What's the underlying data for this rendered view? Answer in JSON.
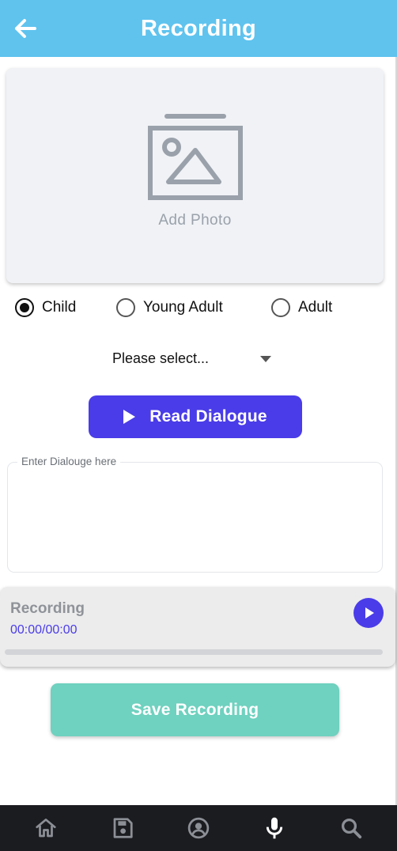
{
  "header": {
    "title": "Recording",
    "color": "#5fc3ee",
    "back_icon": "arrow-left-icon"
  },
  "photo": {
    "label": "Add Photo",
    "icon": "image-placeholder-icon"
  },
  "age_group": {
    "options": [
      {
        "label": "Child",
        "checked": true
      },
      {
        "label": "Young Adult",
        "checked": false
      },
      {
        "label": "Adult",
        "checked": false
      }
    ]
  },
  "select": {
    "value": "Please select..."
  },
  "read_button": {
    "label": "Read Dialogue",
    "icon": "play-icon",
    "color": "#4a3ce8"
  },
  "dialogue": {
    "placeholder": "Enter Dialouge here",
    "value": ""
  },
  "recorder": {
    "title": "Recording",
    "time": "00:00/00:00",
    "progress": 0,
    "play_icon": "play-circle-icon"
  },
  "save_button": {
    "label": "Save Recording",
    "color": "#6fd1bf"
  },
  "nav": {
    "items": [
      {
        "icon": "home-icon",
        "active": false
      },
      {
        "icon": "save-icon",
        "active": false
      },
      {
        "icon": "account-icon",
        "active": false
      },
      {
        "icon": "microphone-icon",
        "active": true
      },
      {
        "icon": "search-icon",
        "active": false
      }
    ]
  }
}
